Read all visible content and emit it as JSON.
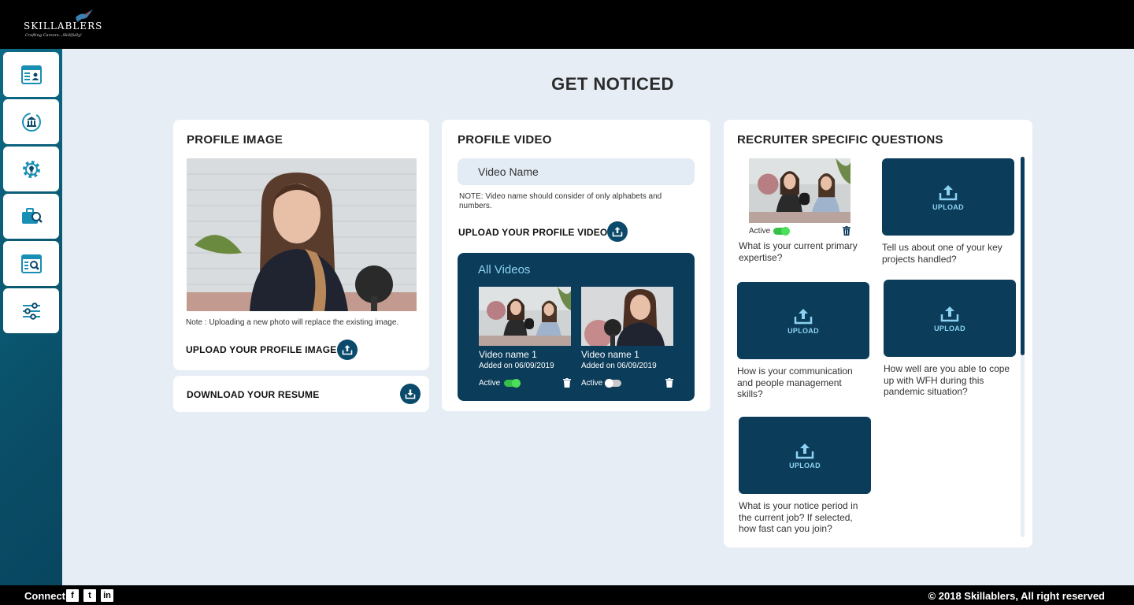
{
  "brand": {
    "name": "SKILLABLERS",
    "tagline": "Crafting Careers...Skillfully!"
  },
  "sidebar": {
    "items": [
      {
        "name": "profile-card-icon"
      },
      {
        "name": "bank-cycle-icon"
      },
      {
        "name": "gear-bulb-icon"
      },
      {
        "name": "briefcase-search-icon"
      },
      {
        "name": "browser-search-icon"
      },
      {
        "name": "sliders-icon"
      }
    ]
  },
  "page": {
    "title": "GET NOTICED"
  },
  "profile_image": {
    "title": "PROFILE IMAGE",
    "note": "Note : Uploading a new photo will replace the existing image.",
    "upload_label": "UPLOAD YOUR PROFILE IMAGE"
  },
  "resume": {
    "download_label": "DOWNLOAD YOUR RESUME"
  },
  "profile_video": {
    "title": "PROFILE VIDEO",
    "name_placeholder": "Video Name",
    "note": "NOTE: Video name should consider of only alphabets and numbers.",
    "upload_label": "UPLOAD YOUR PROFILE VIDEO",
    "all_videos_title": "All Videos",
    "videos": [
      {
        "name": "Video name 1",
        "added": "Added on 06/09/2019",
        "status_label": "Active",
        "active": true
      },
      {
        "name": "Video name 1",
        "added": "Added on 06/09/2019",
        "status_label": "Active",
        "active": false
      }
    ]
  },
  "recruiter": {
    "title": "RECRUITER SPECIFIC QUESTIONS",
    "upload_label": "UPLOAD",
    "active_label": "Active",
    "questions": [
      "What is your current primary expertise?",
      "Tell us about one of your key projects handled?",
      "How is your communication and people management skills?",
      "How well are you able to cope up with WFH during this pandemic situation?",
      "What is your notice period in the current job? If selected, how fast can you join?"
    ]
  },
  "footer": {
    "connect_label": "Connect",
    "social": [
      "f",
      "t",
      "in"
    ],
    "copyright": "© 2018 Skillablers, All right reserved"
  },
  "colors": {
    "navy": "#0b3c5a",
    "accent": "#8dd2f2",
    "toggle_on": "#36c04a",
    "background": "#e6edf5"
  }
}
